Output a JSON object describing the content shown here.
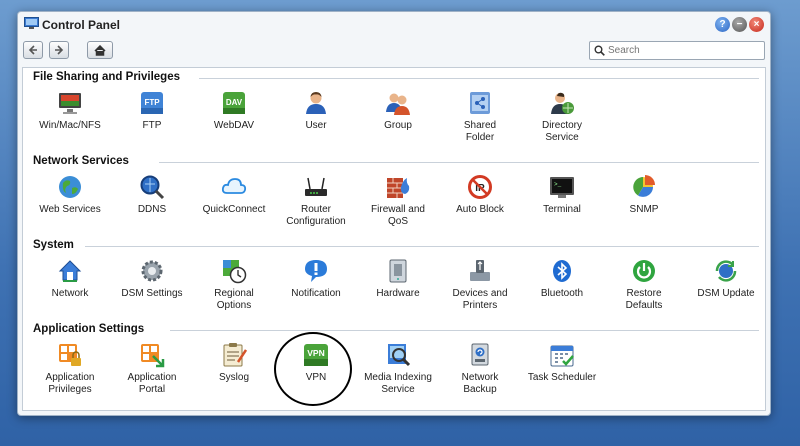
{
  "window": {
    "title": "Control Panel"
  },
  "toolbar": {
    "search_placeholder": "Search"
  },
  "sections": [
    {
      "title": "File Sharing and Privileges",
      "items": [
        {
          "label": "Win/Mac/NFS",
          "icon": "win-mac-nfs-icon"
        },
        {
          "label": "FTP",
          "icon": "ftp-icon"
        },
        {
          "label": "WebDAV",
          "icon": "webdav-icon"
        },
        {
          "label": "User",
          "icon": "user-icon"
        },
        {
          "label": "Group",
          "icon": "group-icon"
        },
        {
          "label": "Shared\nFolder",
          "icon": "shared-folder-icon"
        },
        {
          "label": "Directory\nService",
          "icon": "directory-service-icon"
        }
      ]
    },
    {
      "title": "Network Services",
      "items": [
        {
          "label": "Web Services",
          "icon": "web-services-icon"
        },
        {
          "label": "DDNS",
          "icon": "ddns-icon"
        },
        {
          "label": "QuickConnect",
          "icon": "quickconnect-icon"
        },
        {
          "label": "Router\nConfiguration",
          "icon": "router-icon"
        },
        {
          "label": "Firewall and\nQoS",
          "icon": "firewall-icon"
        },
        {
          "label": "Auto Block",
          "icon": "auto-block-icon"
        },
        {
          "label": "Terminal",
          "icon": "terminal-icon"
        },
        {
          "label": "SNMP",
          "icon": "snmp-icon"
        }
      ]
    },
    {
      "title": "System",
      "items": [
        {
          "label": "Network",
          "icon": "network-icon"
        },
        {
          "label": "DSM Settings",
          "icon": "dsm-settings-icon"
        },
        {
          "label": "Regional\nOptions",
          "icon": "regional-options-icon"
        },
        {
          "label": "Notification",
          "icon": "notification-icon"
        },
        {
          "label": "Hardware",
          "icon": "hardware-icon"
        },
        {
          "label": "Devices and\nPrinters",
          "icon": "devices-printers-icon"
        },
        {
          "label": "Bluetooth",
          "icon": "bluetooth-icon"
        },
        {
          "label": "Restore\nDefaults",
          "icon": "restore-defaults-icon"
        },
        {
          "label": "DSM Update",
          "icon": "dsm-update-icon"
        }
      ]
    },
    {
      "title": "Application Settings",
      "items": [
        {
          "label": "Application\nPrivileges",
          "icon": "application-privileges-icon"
        },
        {
          "label": "Application\nPortal",
          "icon": "application-portal-icon"
        },
        {
          "label": "Syslog",
          "icon": "syslog-icon"
        },
        {
          "label": "VPN",
          "icon": "vpn-icon",
          "icon_text": "VPN"
        },
        {
          "label": "Media Indexing\nService",
          "icon": "media-indexing-icon"
        },
        {
          "label": "Network\nBackup",
          "icon": "network-backup-icon"
        },
        {
          "label": "Task Scheduler",
          "icon": "task-scheduler-icon"
        }
      ]
    }
  ],
  "icon_texts": {
    "ftp": "FTP",
    "webdav": "DAV",
    "vpn": "VPN"
  }
}
